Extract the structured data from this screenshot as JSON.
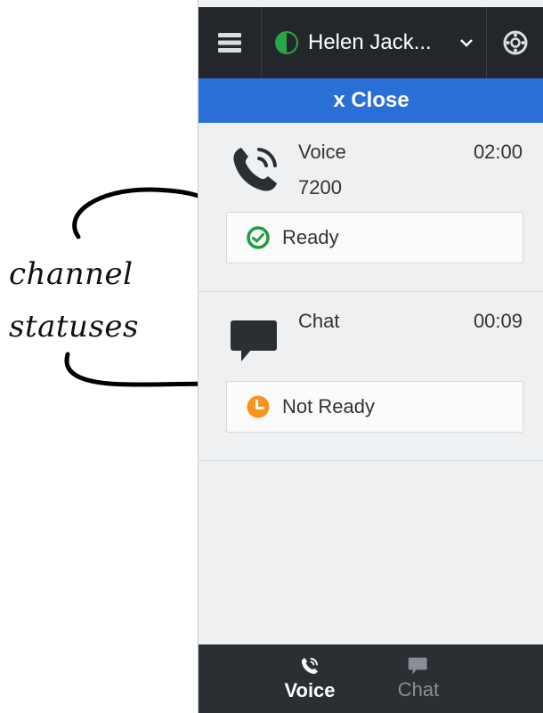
{
  "annotation": {
    "line1": "channel",
    "line2": "statuses"
  },
  "topbar": {
    "menu_icon": "hamburger-menu-icon",
    "user_name": "Helen Jack...",
    "presence_color": "#28a745",
    "settings_icon": "settings-gear-icon"
  },
  "close_bar": {
    "label": "x Close"
  },
  "channels": [
    {
      "name": "Voice",
      "number": "7200",
      "time": "02:00",
      "icon": "phone-call-icon",
      "status": {
        "label": "Ready",
        "icon": "check-circle-icon",
        "color": "#1e9e3c"
      }
    },
    {
      "name": "Chat",
      "time": "00:09",
      "icon": "chat-bubble-icon",
      "status": {
        "label": "Not Ready",
        "icon": "clock-icon",
        "color": "#f7941d"
      }
    }
  ],
  "bottom_tabs": [
    {
      "label": "Voice",
      "icon": "phone-call-icon",
      "active": true
    },
    {
      "label": "Chat",
      "icon": "chat-bubble-icon",
      "active": false
    }
  ],
  "colors": {
    "topbar_bg": "#23272c",
    "close_bg": "#2a6fd6",
    "panel_bg": "#eef0f2"
  }
}
